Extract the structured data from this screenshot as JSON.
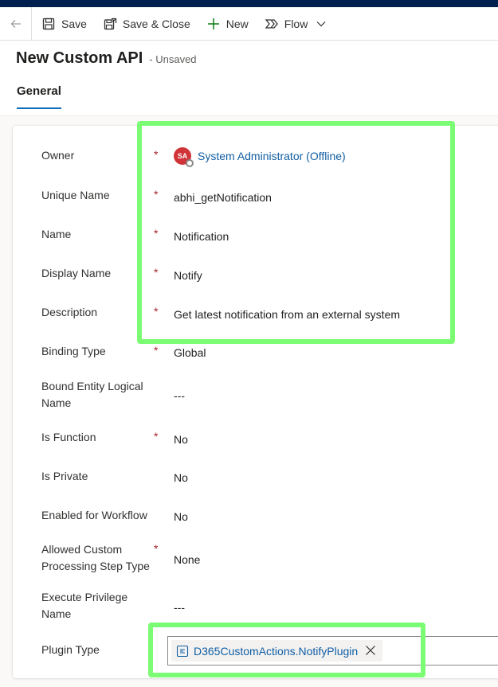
{
  "commandbar": {
    "save_label": "Save",
    "save_close_label": "Save & Close",
    "new_label": "New",
    "flow_label": "Flow"
  },
  "header": {
    "title": "New Custom API",
    "status": "- Unsaved"
  },
  "tabs": [
    {
      "label": "General",
      "selected": true
    }
  ],
  "form": {
    "owner": {
      "label": "Owner",
      "required": true,
      "avatar_initials": "SA",
      "value": "System Administrator (Offline)"
    },
    "unique_name": {
      "label": "Unique Name",
      "required": true,
      "value": "abhi_getNotification"
    },
    "name": {
      "label": "Name",
      "required": true,
      "value": "Notification"
    },
    "display_name": {
      "label": "Display Name",
      "required": true,
      "value": "Notify"
    },
    "description": {
      "label": "Description",
      "required": true,
      "value": "Get latest notification from an external system"
    },
    "binding_type": {
      "label": "Binding Type",
      "required": true,
      "value": "Global"
    },
    "bound_entity": {
      "label": "Bound Entity Logical Name",
      "required": false,
      "value": "---"
    },
    "is_function": {
      "label": "Is Function",
      "required": true,
      "value": "No"
    },
    "is_private": {
      "label": "Is Private",
      "required": false,
      "value": "No"
    },
    "enabled_workflow": {
      "label": "Enabled for Workflow",
      "required": false,
      "value": "No"
    },
    "allowed_step": {
      "label": "Allowed Custom Processing Step Type",
      "required": true,
      "value": "None"
    },
    "execute_privilege": {
      "label": "Execute Privilege Name",
      "required": false,
      "value": "---"
    },
    "plugin_type": {
      "label": "Plugin Type",
      "required": false,
      "value": "D365CustomActions.NotifyPlugin"
    }
  },
  "required_marker": "*",
  "colors": {
    "highlight": "#7cfc74",
    "required": "#a4262c",
    "link": "#115ea3",
    "accent": "#0f6cbd"
  }
}
